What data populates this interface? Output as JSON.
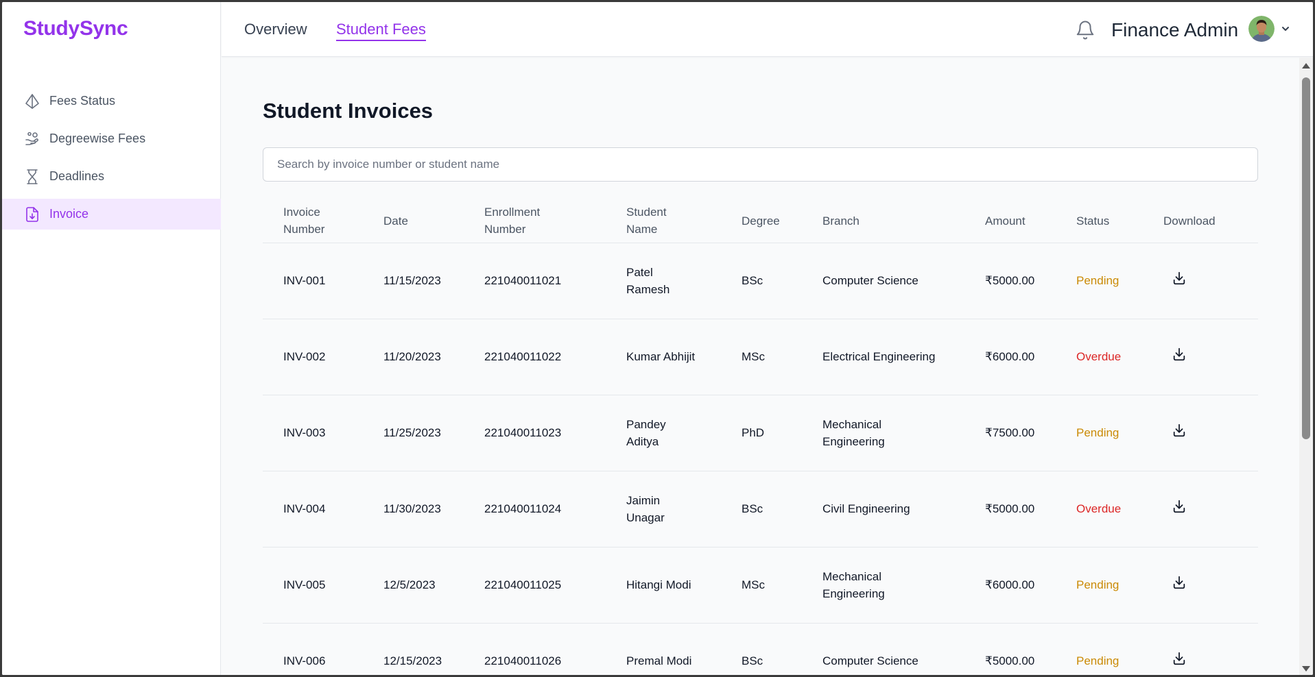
{
  "brand": "StudySync",
  "sidebar": {
    "items": [
      {
        "label": "Fees Status",
        "icon": "pyramid-icon"
      },
      {
        "label": "Degreewise Fees",
        "icon": "hand-coins-icon"
      },
      {
        "label": "Deadlines",
        "icon": "hourglass-icon"
      },
      {
        "label": "Invoice",
        "icon": "file-download-icon",
        "active": true
      }
    ]
  },
  "header": {
    "tabs": [
      {
        "label": "Overview"
      },
      {
        "label": "Student Fees",
        "active": true
      }
    ],
    "user_name": "Finance Admin"
  },
  "main": {
    "title": "Student Invoices",
    "search_placeholder": "Search by invoice number or student name",
    "columns": [
      "Invoice Number",
      "Date",
      "Enrollment Number",
      "Student Name",
      "Degree",
      "Branch",
      "Amount",
      "Status",
      "Download"
    ],
    "rows": [
      {
        "invoice": "INV-001",
        "date": "11/15/2023",
        "enrollment": "221040011021",
        "name": "Patel Ramesh",
        "degree": "BSc",
        "branch": "Computer Science",
        "amount": "₹5000.00",
        "status": "Pending"
      },
      {
        "invoice": "INV-002",
        "date": "11/20/2023",
        "enrollment": "221040011022",
        "name": "Kumar Abhijit",
        "degree": "MSc",
        "branch": "Electrical Engineering",
        "amount": "₹6000.00",
        "status": "Overdue"
      },
      {
        "invoice": "INV-003",
        "date": "11/25/2023",
        "enrollment": "221040011023",
        "name": "Pandey Aditya",
        "degree": "PhD",
        "branch": "Mechanical Engineering",
        "amount": "₹7500.00",
        "status": "Pending"
      },
      {
        "invoice": "INV-004",
        "date": "11/30/2023",
        "enrollment": "221040011024",
        "name": "Jaimin Unagar",
        "degree": "BSc",
        "branch": "Civil Engineering",
        "amount": "₹5000.00",
        "status": "Overdue"
      },
      {
        "invoice": "INV-005",
        "date": "12/5/2023",
        "enrollment": "221040011025",
        "name": "Hitangi Modi",
        "degree": "MSc",
        "branch": "Mechanical Engineering",
        "amount": "₹6000.00",
        "status": "Pending"
      },
      {
        "invoice": "INV-006",
        "date": "12/15/2023",
        "enrollment": "221040011026",
        "name": "Premal Modi",
        "degree": "BSc",
        "branch": "Computer Science",
        "amount": "₹5000.00",
        "status": "Pending"
      }
    ]
  },
  "colors": {
    "accent": "#9333ea",
    "pending": "#ca8a04",
    "overdue": "#dc2626"
  }
}
